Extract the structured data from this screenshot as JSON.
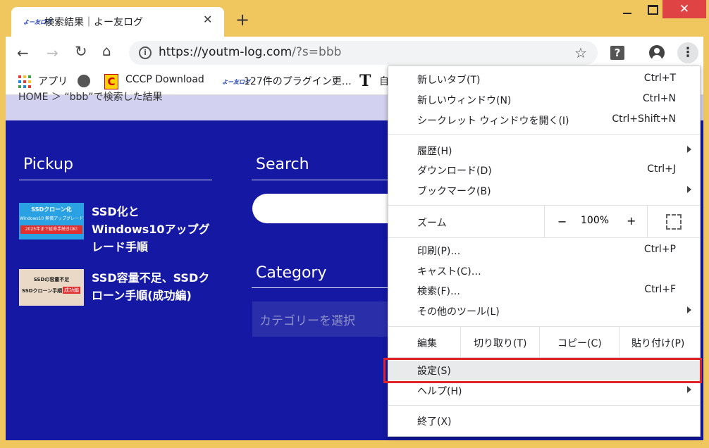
{
  "tab": {
    "title": "検索結果｜よー友ログ",
    "favicon_text": "よー友ログ",
    "close": "✕",
    "new_tab": "+"
  },
  "window": {
    "close": "✕"
  },
  "toolbar": {
    "back": "←",
    "forward": "→",
    "reload": "↻",
    "home": "⌂",
    "url_host": "https://youtm-log.com",
    "url_path": "/?s=bbb",
    "info": "i",
    "star": "☆",
    "ext": "?",
    "menu": "⋮"
  },
  "bookmarks": [
    {
      "label": "アプリ",
      "icon": "apps-grid-icon"
    },
    {
      "label": "",
      "icon": "globe-icon"
    },
    {
      "label": "CCCP Download",
      "icon": "cccp-icon",
      "icon_text": "C"
    },
    {
      "label": "127件のプラグイン更…",
      "icon": "youtm-icon",
      "icon_text": "よー友ログ"
    },
    {
      "label": "自",
      "icon": "t-icon",
      "icon_text": "T"
    }
  ],
  "page": {
    "breadcrumb": "HOME ＞ “bbb”で検索した結果",
    "pickup_heading": "Pickup",
    "search_heading": "Search",
    "category_heading": "Category",
    "category_placeholder": "カテゴリーを選択",
    "pickups": [
      {
        "title": "SSD化とWindows10アップグレード手順",
        "thumb_line1": "SSDクローン化",
        "thumb_line2": "Windows10 無償アップグレード",
        "thumb_line3": "2025年まで延命手続きOK!"
      },
      {
        "title": "SSD容量不足、SSDクローン手順(成功編)",
        "thumb_line1": "SSDの容量不足",
        "thumb_line2": "SSDクローン手順",
        "thumb_badge": "成功編"
      }
    ]
  },
  "menu": {
    "new_tab": {
      "label": "新しいタブ(T)",
      "shortcut": "Ctrl+T"
    },
    "new_window": {
      "label": "新しいウィンドウ(N)",
      "shortcut": "Ctrl+N"
    },
    "incognito": {
      "label": "シークレット ウィンドウを開く(I)",
      "shortcut": "Ctrl+Shift+N"
    },
    "history": {
      "label": "履歴(H)"
    },
    "downloads": {
      "label": "ダウンロード(D)",
      "shortcut": "Ctrl+J"
    },
    "bookmarks": {
      "label": "ブックマーク(B)"
    },
    "zoom": {
      "label": "ズーム",
      "minus": "−",
      "value": "100%",
      "plus": "+"
    },
    "print": {
      "label": "印刷(P)…",
      "shortcut": "Ctrl+P"
    },
    "cast": {
      "label": "キャスト(C)…"
    },
    "find": {
      "label": "検索(F)…",
      "shortcut": "Ctrl+F"
    },
    "more_tools": {
      "label": "その他のツール(L)"
    },
    "edit": {
      "label": "編集",
      "cut": "切り取り(T)",
      "copy": "コピー(C)",
      "paste": "貼り付け(P)"
    },
    "settings": {
      "label": "設定(S)"
    },
    "help": {
      "label": "ヘルプ(H)"
    },
    "exit": {
      "label": "終了(X)"
    }
  },
  "colors": {
    "page_bg": "#1418a2",
    "frame": "#f0c75e",
    "highlight": "#e0222b"
  }
}
